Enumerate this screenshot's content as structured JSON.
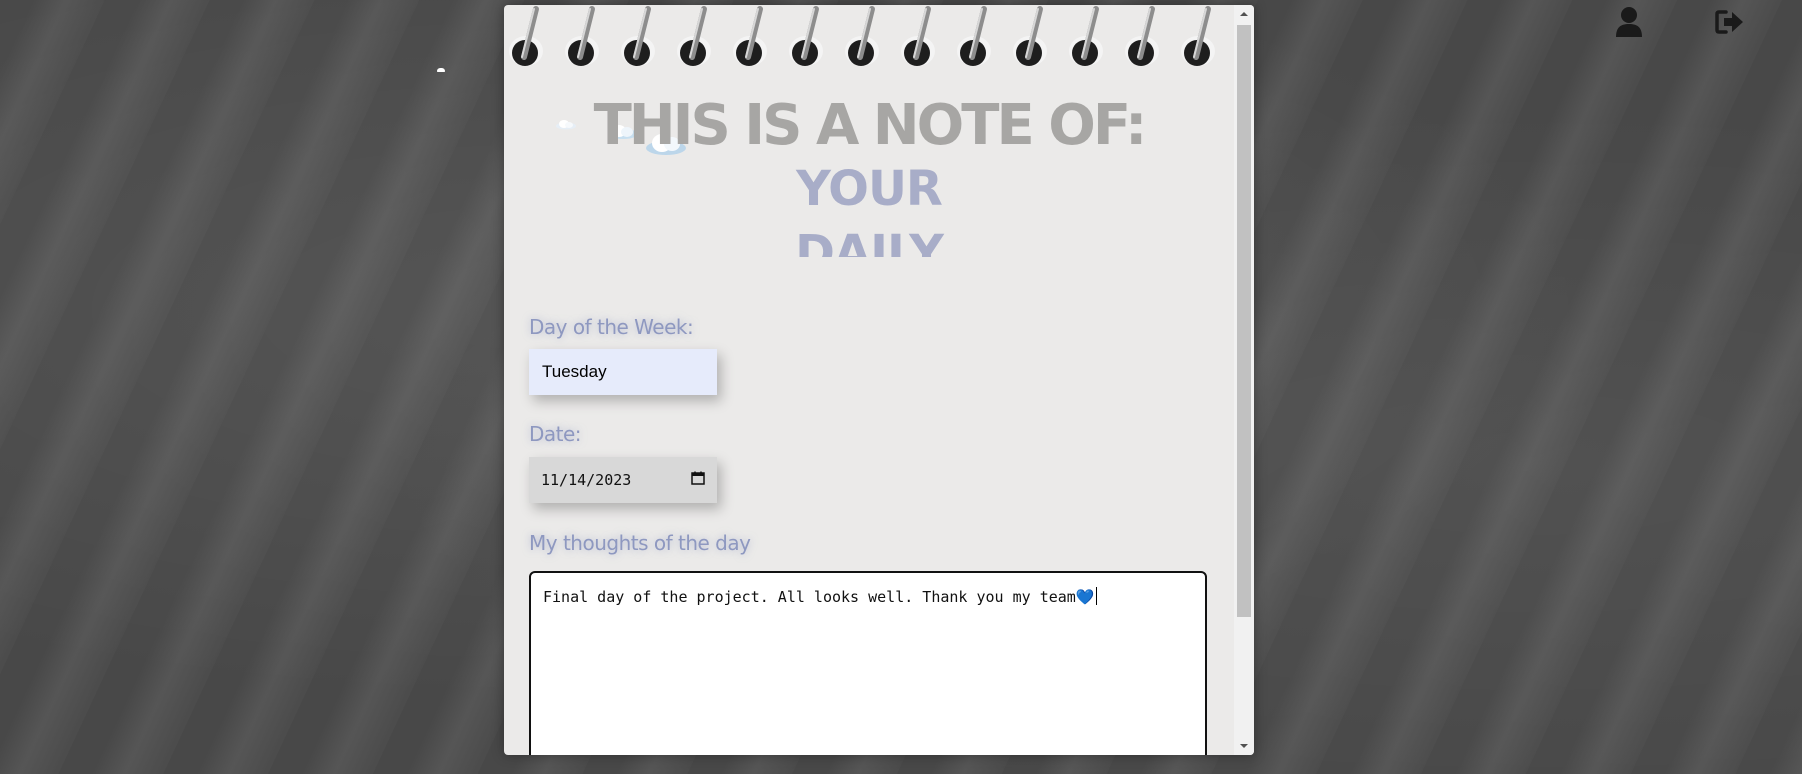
{
  "header": {
    "profile_icon": "user-icon",
    "logout_icon": "sign-out-icon"
  },
  "note": {
    "title": "THIS IS A NOTE OF:",
    "rotating_words": [
      "YOUR",
      "DAILY"
    ],
    "day_label": "Day of the Week:",
    "day_value": "Tuesday",
    "date_label": "Date:",
    "date_value": "11/14/2023",
    "thoughts_label": "My thoughts of the day",
    "thoughts_value": "Final day of the project. All looks well. Thank you my team💙"
  },
  "colors": {
    "label": "#8e98c0",
    "title": "#a7a6a4",
    "scroll_word": "#a8adc8",
    "day_field_bg": "#e6ebfb",
    "heart": "#7ec8e3"
  }
}
